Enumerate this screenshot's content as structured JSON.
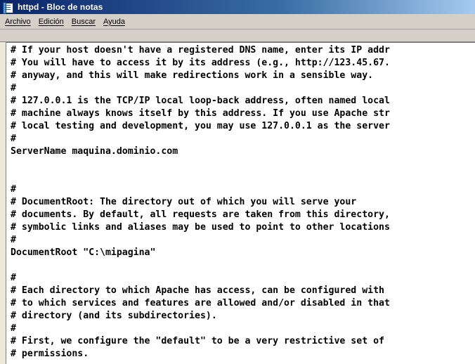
{
  "window": {
    "title": "httpd - Bloc de notas"
  },
  "menu": {
    "items": [
      {
        "label": "Archivo"
      },
      {
        "label": "Edición"
      },
      {
        "label": "Buscar"
      },
      {
        "label": "Ayuda"
      }
    ]
  },
  "editor": {
    "lines": [
      "# If your host doesn't have a registered DNS name, enter its IP addr",
      "# You will have to access it by its address (e.g., http://123.45.67.",
      "# anyway, and this will make redirections work in a sensible way.",
      "#",
      "# 127.0.0.1 is the TCP/IP local loop-back address, often named local",
      "# machine always knows itself by this address. If you use Apache str",
      "# local testing and development, you may use 127.0.0.1 as the server",
      "#",
      "ServerName maquina.dominio.com",
      "",
      "",
      "#",
      "# DocumentRoot: The directory out of which you will serve your",
      "# documents. By default, all requests are taken from this directory,",
      "# symbolic links and aliases may be used to point to other locations",
      "#",
      "DocumentRoot \"C:\\mipagina\"",
      "",
      "#",
      "# Each directory to which Apache has access, can be configured with",
      "# to which services and features are allowed and/or disabled in that",
      "# directory (and its subdirectories).",
      "#",
      "# First, we configure the \"default\" to be a very restrictive set of",
      "# permissions."
    ]
  }
}
